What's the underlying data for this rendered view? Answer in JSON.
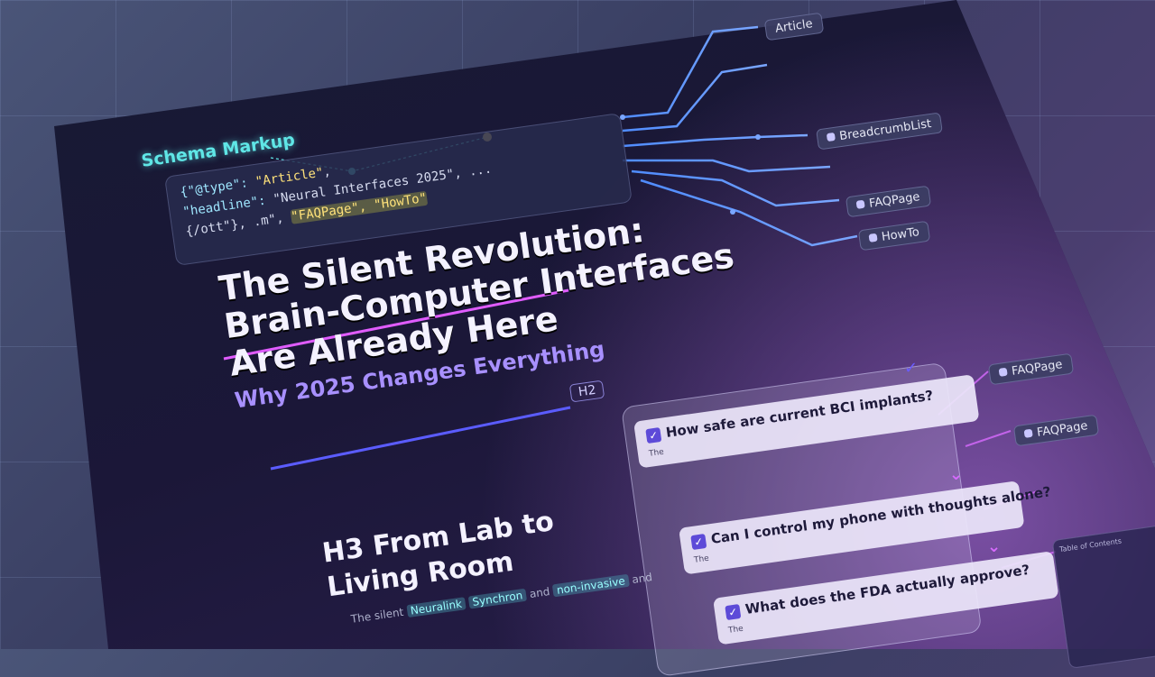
{
  "schema": {
    "title": "Schema Markup",
    "code_lines": [
      [
        "{\"@type\": ",
        "\"Article\"",
        ","
      ],
      [
        "  \"headline\": ",
        "\"Neural Interfaces 2025\"",
        ", ..."
      ],
      [
        "{/ott\"}, .m\", ",
        "\"FAQPage\", \"HowTo\"",
        ""
      ]
    ]
  },
  "schema_types": {
    "article": "Article",
    "breadcrumb": "BreadcrumbList",
    "faqpage": "FAQPage",
    "howto": "HowTo",
    "faq_side_1": "FAQPage",
    "faq_side_2": "FAQPage"
  },
  "article": {
    "title_line1": "The Silent Revolution:",
    "title_line2": "Brain-Computer Interfaces",
    "title_line3": "Are Already Here",
    "subtitle": "Why 2025 Changes Everything",
    "h2_tag": "H2",
    "h3_line1": "H3 From Lab to",
    "h3_line2": "Living Room",
    "body_prefix": "The silent",
    "body_pill1": "Neuralink",
    "body_pill2": "Synchron",
    "body_and": "and",
    "body_pill3": "non-invasive",
    "body_suffix": "and"
  },
  "faq": {
    "items": [
      {
        "question": "How safe are current BCI implants?",
        "answer": "The"
      },
      {
        "question": "Can I control my phone with thoughts alone?",
        "answer": "The"
      },
      {
        "question": "What does the FDA actually approve?",
        "answer": "The"
      }
    ]
  },
  "toc": {
    "title": "Table of Contents"
  },
  "colors": {
    "accent_cyan": "#5fe6e6",
    "accent_purple": "#a890ff",
    "line_blue": "#4f8cff"
  }
}
